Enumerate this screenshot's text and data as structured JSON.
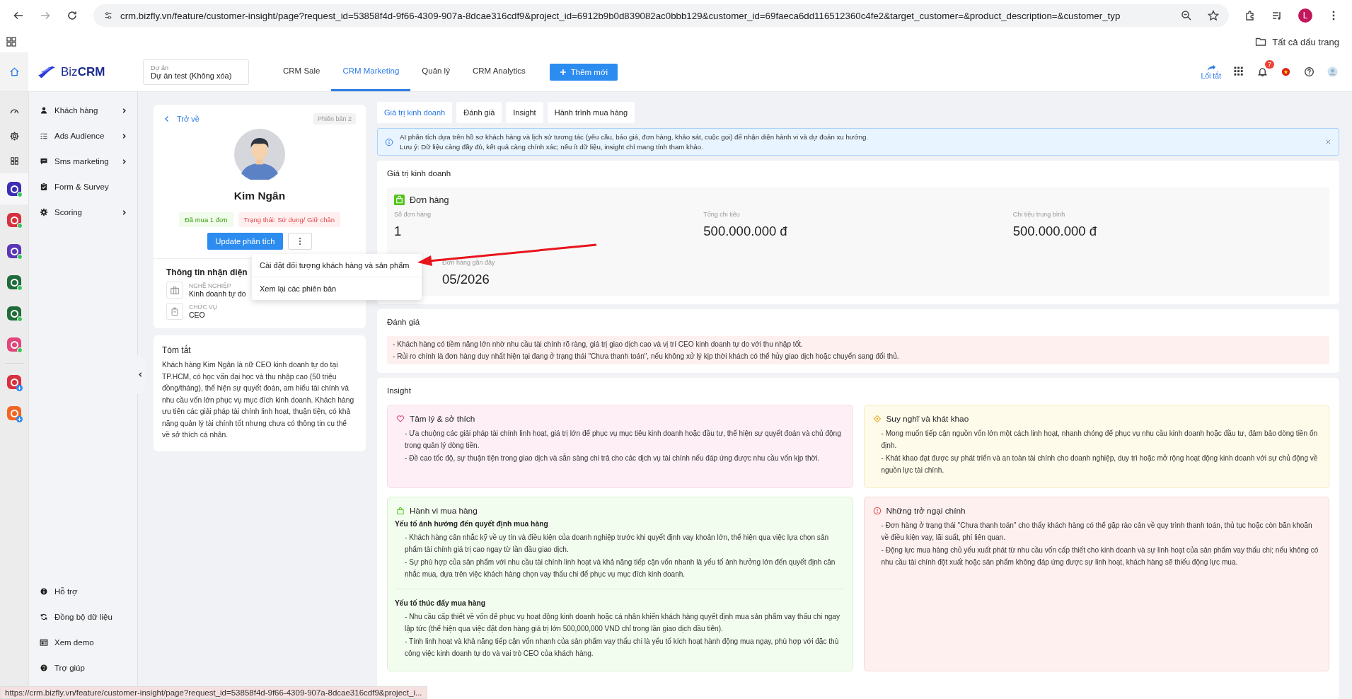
{
  "browser": {
    "url": "crm.bizfly.vn/feature/customer-insight/page?request_id=53858f4d-9f66-4309-907a-8dcae316cdf9&project_id=6912b9b0d839082ac0bbb129&customer_id=69faeca6dd116512360c4fe2&target_customer=&product_description=&customer_typ",
    "profile": "L",
    "bookmarks_label": "Tất cả dấu trang"
  },
  "header": {
    "logo": "Biz**CRM**",
    "project_label": "Dự án",
    "project_value": "Dự án test (Không xóa)",
    "nav": [
      {
        "label": "CRM Sale",
        "selected": false
      },
      {
        "label": "CRM Marketing",
        "selected": true
      },
      {
        "label": "Quản lý",
        "selected": false
      },
      {
        "label": "CRM Analytics",
        "selected": false
      }
    ],
    "add_button": "Thêm mới",
    "shortcuts": "Lối tắt",
    "notification_count": "7"
  },
  "rail_apps": [
    {
      "color": "#3b2db5",
      "selected": true,
      "kind": "installed"
    },
    {
      "color": "#d9303e",
      "selected": false,
      "kind": "installed"
    },
    {
      "color": "#5a35b8",
      "selected": false,
      "kind": "installed"
    },
    {
      "color": "#1f6b3a",
      "selected": false,
      "kind": "installed"
    },
    {
      "color": "#1f6b3a",
      "selected": false,
      "kind": "installed"
    },
    {
      "color": "#e0457b",
      "selected": false,
      "kind": "installed"
    },
    {
      "color": "#d9303e",
      "selected": false,
      "kind": "addable"
    },
    {
      "color": "#f26522",
      "selected": false,
      "kind": "addable"
    }
  ],
  "sidebar": {
    "items": [
      {
        "label": "Khách hàng",
        "expandable": true
      },
      {
        "label": "Ads Audience",
        "expandable": true
      },
      {
        "label": "Sms marketing",
        "expandable": true
      },
      {
        "label": "Form & Survey",
        "expandable": false
      },
      {
        "label": "Scoring",
        "expandable": true
      }
    ],
    "bottom_items": [
      "Hỗ trợ",
      "Đồng bộ dữ liệu",
      "Xem demo",
      "Trợ giúp"
    ]
  },
  "profile": {
    "back": "Trở về",
    "version": "Phiên bản 2",
    "name": "Kim Ngân",
    "tags": [
      "Đã mua 1 đơn",
      "Trạng thái: Sử dụng/ Giữ chân"
    ],
    "update_button": "Update phân tích",
    "menu": {
      "open": true,
      "items": [
        "Cài đặt đối tượng khách hàng và sản phẩm",
        "Xem lại các phiên bản"
      ]
    },
    "identity_title": "Thông tin nhận diện",
    "identity": [
      {
        "label": "NGHỀ NGHIỆP",
        "value": "Kinh doanh tự do"
      },
      {
        "label": "CHỨC VỤ",
        "value": "CEO"
      }
    ],
    "summary_title": "Tóm tắt",
    "summary": "Khách hàng Kim Ngân là nữ CEO kinh doanh tự do tại TP.HCM, có học vấn đại học và thu nhập cao (50 triệu đồng/tháng), thể hiện sự quyết đoán, am hiểu tài chính và nhu cầu vốn lớn phục vụ mục đích kinh doanh. Khách hàng ưu tiên các giải pháp tài chính linh hoạt, thuận tiện, có khả năng quản lý tài chính tốt nhưng chưa có thông tin cụ thể về sở thích cá nhân."
  },
  "main_tabs": [
    {
      "label": "Giá trị kinh doanh",
      "selected": true
    },
    {
      "label": "Đánh giá",
      "selected": false
    },
    {
      "label": "Insight",
      "selected": false
    },
    {
      "label": "Hành trình mua hàng",
      "selected": false
    }
  ],
  "notice": [
    "AI phân tích dựa trên hồ sơ khách hàng và lịch sử tương tác (yêu cầu, báo giá, đơn hàng, khảo sát, cuộc gọi) để nhận diện hành vi và dự đoán xu hướng.",
    "Lưu ý: Dữ liệu càng đầy đủ, kết quả càng chính xác; nếu ít dữ liệu, insight chỉ mang tính tham khảo."
  ],
  "business_value": {
    "title": "Giá trị kinh doanh",
    "orders_title": "Đơn hàng",
    "stats": [
      {
        "label": "Số đơn hàng",
        "value": "1"
      },
      {
        "label": "Tổng chi tiêu",
        "value": "500.000.000 đ"
      },
      {
        "label": "Chi tiêu trung bình",
        "value": "500.000.000 đ"
      }
    ],
    "recent_label": "Đơn hàng gần đây",
    "recent_value": "05/2026"
  },
  "assessment": {
    "title": "Đánh giá",
    "lines": [
      "- Khách hàng có tiềm năng lớn nhờ nhu cầu tài chính rõ ràng, giá trị giao dịch cao và vị trí CEO kinh doanh tự do với thu nhập tốt.",
      "- Rủi ro chính là đơn hàng duy nhất hiện tại đang ở trạng thái \"Chưa thanh toán\", nếu không xử lý kịp thời khách có thể hủy giao dịch hoặc chuyển sang đối thủ."
    ]
  },
  "insight": {
    "title": "Insight",
    "cards": [
      {
        "kind": "interest",
        "title": "Tâm lý & sở thích",
        "sections": [
          {
            "lines": [
              "- Ưa chuộng các giải pháp tài chính linh hoạt, giá trị lớn để phục vụ mục tiêu kinh doanh hoặc đầu tư, thể hiện sự quyết đoán và chủ động trong quản lý dòng tiền.",
              "- Đề cao tốc độ, sự thuận tiện trong giao dịch và sẵn sàng chi trả cho các dịch vụ tài chính nếu đáp ứng được nhu cầu vốn kịp thời."
            ]
          }
        ]
      },
      {
        "kind": "desire",
        "title": "Suy nghĩ và khát khao",
        "sections": [
          {
            "lines": [
              "- Mong muốn tiếp cận nguồn vốn lớn một cách linh hoạt, nhanh chóng để phục vụ nhu cầu kinh doanh hoặc đầu tư, đảm bảo dòng tiền ổn định.",
              "- Khát khao đạt được sự phát triển và an toàn tài chính cho doanh nghiệp, duy trì hoặc mở rộng hoạt động kinh doanh với sự chủ động về nguồn lực tài chính."
            ]
          }
        ]
      },
      {
        "kind": "behavior",
        "title": "Hành vi mua hàng",
        "sections": [
          {
            "heading": "Yếu tố ảnh hưởng đến quyết định mua hàng",
            "lines": [
              "- Khách hàng cân nhắc kỹ về uy tín và điều kiện của doanh nghiệp trước khi quyết định vay khoản lớn, thể hiện qua việc lựa chọn sản phẩm tài chính giá trị cao ngay từ lần đầu giao dịch.",
              "- Sự phù hợp của sản phẩm với nhu cầu tài chính linh hoạt và khả năng tiếp cận vốn nhanh là yếu tố ảnh hưởng lớn đến quyết định cân nhắc mua, dựa trên việc khách hàng chọn vay thấu chi để phục vụ mục đích kinh doanh."
            ]
          },
          {
            "heading": "Yếu tố thúc đẩy mua hàng",
            "lines": [
              "- Nhu cầu cấp thiết về vốn để phục vụ hoạt động kinh doanh hoặc cá nhân khiến khách hàng quyết định mua sản phẩm vay thấu chi ngay lập tức (thể hiện qua việc đặt đơn hàng giá trị lớn 500,000,000 VND chỉ trong lần giao dịch đầu tiên).",
              "- Tính linh hoạt và khả năng tiếp cận vốn nhanh của sản phẩm vay thấu chi là yếu tố kích hoạt hành động mua ngay, phù hợp với đặc thù công việc kinh doanh tự do và vai trò CEO của khách hàng."
            ]
          }
        ]
      },
      {
        "kind": "obstacle",
        "title": "Những trở ngại chính",
        "sections": [
          {
            "lines": [
              "- Đơn hàng ở trạng thái \"Chưa thanh toán\" cho thấy khách hàng có thể gặp rào cản về quy trình thanh toán, thủ tục hoặc còn băn khoăn về điều kiện vay, lãi suất, phí liên quan.",
              "- Động lực mua hàng chủ yếu xuất phát từ nhu cầu vốn cấp thiết cho kinh doanh và sự linh hoạt của sản phẩm vay thấu chi; nếu không có nhu cầu tài chính đột xuất hoặc sản phẩm không đáp ứng được sự linh hoạt, khách hàng sẽ thiếu động lực mua."
            ]
          }
        ]
      }
    ]
  },
  "status_url": "https://crm.bizfly.vn/feature/customer-insight/page?request_id=53858f4d-9f66-4309-907a-8dcae316cdf9&project_i..."
}
